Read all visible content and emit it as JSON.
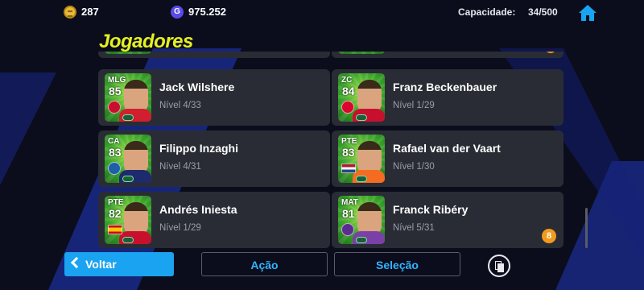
{
  "header": {
    "coins": "287",
    "gp": "975.252",
    "gp_icon_letter": "G",
    "capacity_label": "Capacidade:",
    "capacity_value": "34/500"
  },
  "page": {
    "title": "Jogadores"
  },
  "players": [
    {
      "position": "MLG",
      "rating": "85",
      "name": "Jack Wilshere",
      "level": "Nível 4/33",
      "shirt_color": "#d11f2f",
      "emblem": "club-badge"
    },
    {
      "position": "ZC",
      "rating": "84",
      "name": "Franz Beckenbauer",
      "level": "Nível 1/29",
      "shirt_color": "#c8102e",
      "emblem": "club-badge"
    },
    {
      "position": "CA",
      "rating": "83",
      "name": "Filippo Inzaghi",
      "level": "Nível 4/31",
      "shirt_color": "#1e2a6e",
      "emblem": "club-badge"
    },
    {
      "position": "PTE",
      "rating": "83",
      "name": "Rafael van der Vaart",
      "level": "Nível 1/30",
      "shirt_color": "#f36c21",
      "emblem": "flag-netherlands"
    },
    {
      "position": "PTE",
      "rating": "82",
      "name": "Andrés Iniesta",
      "level": "Nível 1/29",
      "shirt_color": "#c8102e",
      "emblem": "flag-spain"
    },
    {
      "position": "MAT",
      "rating": "81",
      "name": "Franck Ribéry",
      "level": "Nível 5/31",
      "shirt_color": "#7b3fa8",
      "emblem": "club-badge",
      "notification": "8"
    }
  ],
  "footer": {
    "back_label": "Voltar",
    "action_label": "Ação",
    "selection_label": "Seleção"
  },
  "colors": {
    "accent_blue": "#1aa3f0",
    "title_yellow": "#e6f020",
    "card_bg": "#2a2c35",
    "notification_orange": "#f29a1d"
  }
}
